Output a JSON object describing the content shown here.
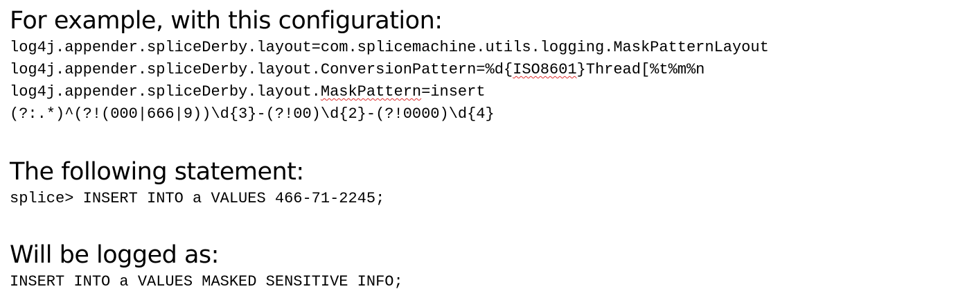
{
  "sections": [
    {
      "heading": "For example, with this configuration:",
      "lines": [
        "log4j.appender.spliceDerby.layout=com.splicemachine.utils.logging.MaskPatternLayout",
        "log4j.appender.spliceDerby.layout.ConversionPattern=%d{ISO8601}Thread[%t%m%n",
        "log4j.appender.spliceDerby.layout.MaskPattern=insert",
        "(?:.*)^(?!(000|666|9))\\d{3}-(?!00)\\d{2}-(?!0000)\\d{4}"
      ],
      "line2": {
        "before": "log4j.appender.spliceDerby.layout.ConversionPattern=%d{",
        "flagged": "ISO8601",
        "after": "}Thread[%t%m%n"
      },
      "line3": {
        "before": "log4j.appender.spliceDerby.layout.",
        "flagged": "MaskPattern",
        "after": "=insert"
      }
    },
    {
      "heading": "The following statement:",
      "lines": [
        "splice> INSERT INTO a VALUES 466-71-2245;"
      ]
    },
    {
      "heading": "Will be logged as:",
      "lines": [
        "INSERT INTO a VALUES MASKED SENSITIVE INFO;"
      ]
    }
  ],
  "spellcheck_underline_color": "#e03030"
}
